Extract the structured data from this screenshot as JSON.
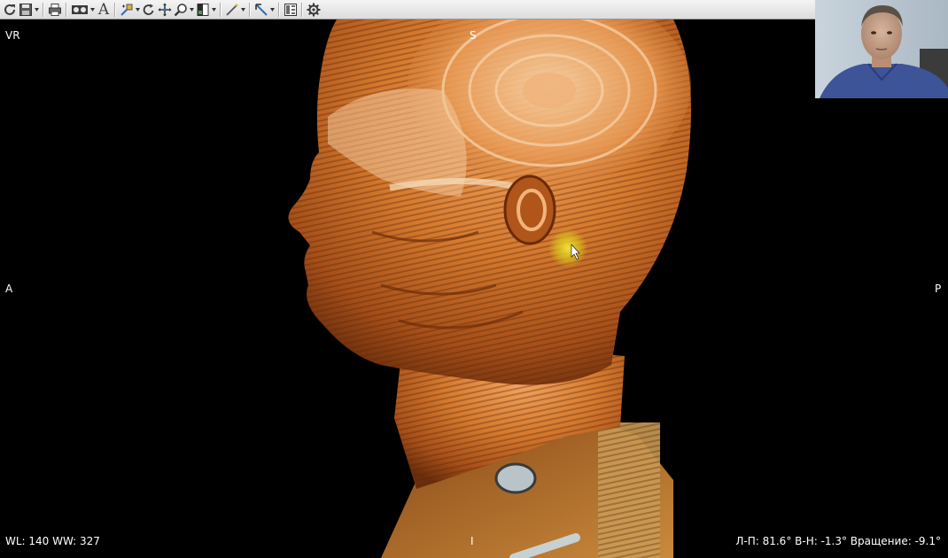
{
  "toolbar": {
    "tools": [
      {
        "name": "refresh-icon"
      },
      {
        "name": "save-icon"
      },
      {
        "name": "print-icon"
      },
      {
        "name": "layout-icon"
      },
      {
        "name": "text-annotation-icon",
        "label": "A"
      },
      {
        "name": "measure-icon"
      },
      {
        "name": "rotate-icon"
      },
      {
        "name": "pan-icon"
      },
      {
        "name": "zoom-icon"
      },
      {
        "name": "window-level-icon"
      },
      {
        "name": "draw-line-icon"
      },
      {
        "name": "angle-tool-icon"
      },
      {
        "name": "series-panel-icon"
      },
      {
        "name": "settings-icon"
      }
    ],
    "text_tool_label": "A"
  },
  "viewport": {
    "mode_label": "VR",
    "orientation": {
      "top": "S",
      "bottom": "I",
      "left": "A",
      "right": "P"
    },
    "window_level": "WL: 140 WW: 327",
    "rotation": "Л-П: 81.6° В-Н: -1.3° Вращение: -9.1°"
  },
  "colors": {
    "toolbar_bg": "#e6e6e6",
    "viewport_bg": "#000000",
    "render_orange": "#d4782c",
    "render_highlight": "#f6c89a",
    "cursor_glow": "#e8d21a"
  }
}
